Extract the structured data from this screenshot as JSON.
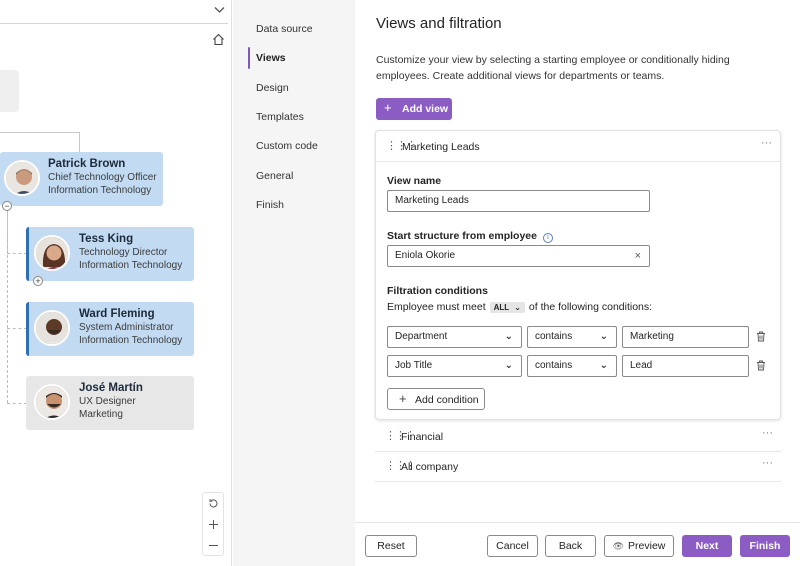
{
  "org": {
    "people": [
      {
        "name": "Patrick Brown",
        "title": "Chief Technology Officer",
        "dept": "Information Technology"
      },
      {
        "name": "Tess King",
        "title": "Technology Director",
        "dept": "Information Technology"
      },
      {
        "name": "Ward Fleming",
        "title": "System Administrator",
        "dept": "Information Technology"
      },
      {
        "name": "José Martín",
        "title": "UX Designer",
        "dept": "Marketing"
      }
    ],
    "collapse_symbol": "−",
    "expand_symbol": "+"
  },
  "nav": {
    "items": [
      "Data source",
      "Views",
      "Design",
      "Templates",
      "Custom code",
      "General",
      "Finish"
    ],
    "active": "Views"
  },
  "main": {
    "title": "Views and filtration",
    "description": "Customize your view by selecting a starting employee or conditionally hiding employees. Create additional views for departments or teams.",
    "add_view_label": "Add view",
    "views": [
      {
        "name": "Marketing Leads"
      },
      {
        "name": "Financial"
      },
      {
        "name": "All company"
      }
    ],
    "editor": {
      "view_name_label": "View name",
      "view_name_value": "Marketing Leads",
      "start_label": "Start structure from employee",
      "start_value": "Eniola Okorie",
      "filtration_label": "Filtration conditions",
      "must_meet_prefix": "Employee must meet",
      "must_meet_value": "ALL",
      "must_meet_suffix": "of the following conditions:",
      "conditions": [
        {
          "field": "Department",
          "operator": "contains",
          "value": "Marketing"
        },
        {
          "field": "Job Title",
          "operator": "contains",
          "value": "Lead"
        }
      ],
      "add_condition_label": "Add condition"
    },
    "footer": {
      "reset": "Reset",
      "cancel": "Cancel",
      "back": "Back",
      "preview": "Preview",
      "next": "Next",
      "finish": "Finish"
    }
  },
  "colors": {
    "accent": "#8b5cc4",
    "card_blue": "#c2dbf3",
    "card_grey": "#e7e7e7"
  }
}
